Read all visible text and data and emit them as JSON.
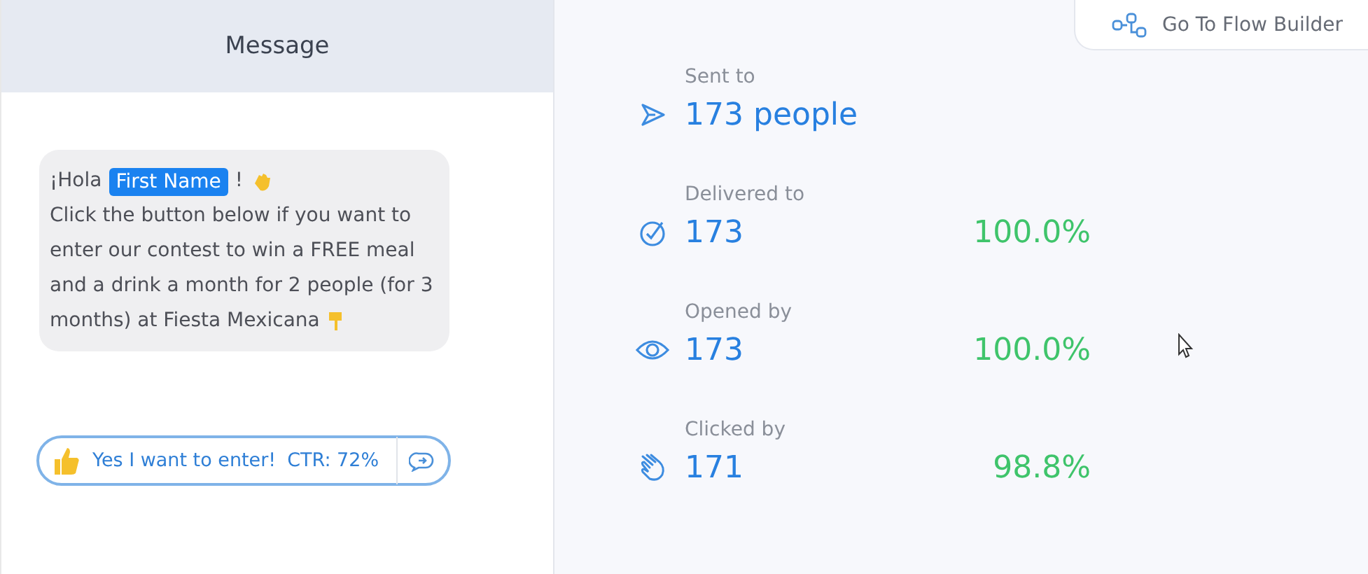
{
  "message_panel": {
    "title": "Message",
    "bubble": {
      "greeting": "¡Hola",
      "name_chip": "First Name",
      "exclamation": "!",
      "body": "Click the button below if you want to enter our contest to win a FREE meal and a drink a month for 2 people (for 3 months) at Fiesta Mexicana"
    },
    "button": {
      "label": "Yes I want to enter!",
      "ctr": "CTR: 72%"
    }
  },
  "flow_button": {
    "label": "Go To Flow Builder"
  },
  "stats": [
    {
      "kind": "sent",
      "label": "Sent to",
      "value": "173 people"
    },
    {
      "kind": "delivered",
      "label": "Delivered to",
      "value": "173",
      "percent": "100.0%"
    },
    {
      "kind": "opened",
      "label": "Opened by",
      "value": "173",
      "percent": "100.0%"
    },
    {
      "kind": "clicked",
      "label": "Clicked by",
      "value": "171",
      "percent": "98.8%"
    }
  ]
}
